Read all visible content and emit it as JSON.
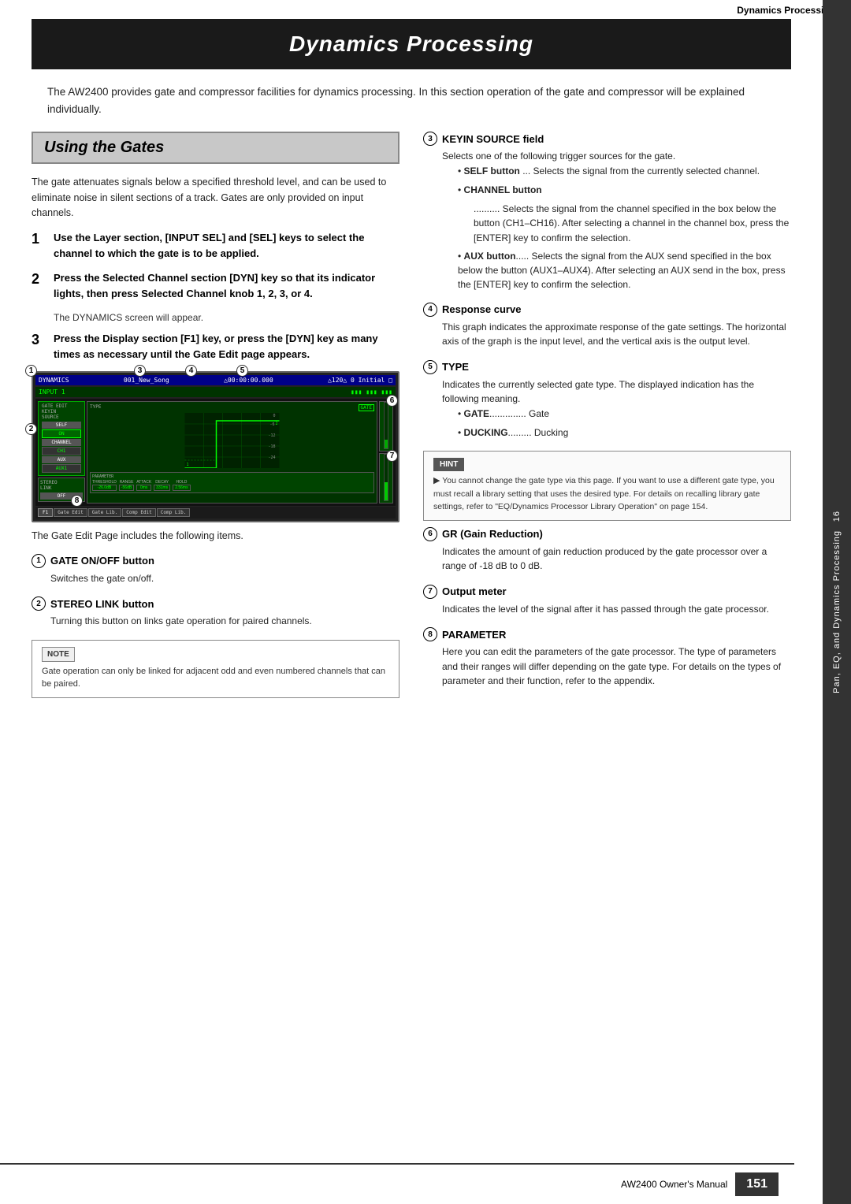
{
  "topBar": {
    "title": "Dynamics Processing"
  },
  "mainTitle": "Dynamics Processing",
  "intro": "The AW2400 provides gate and compressor facilities for dynamics processing. In this section operation of the gate and compressor will be explained individually.",
  "sectionTitle": "Using the Gates",
  "sectionIntro": "The gate attenuates signals below a specified threshold level, and can be used to eliminate noise in silent sections of a track. Gates are only provided on input channels.",
  "steps": [
    {
      "number": "1",
      "text": "Use the Layer section, [INPUT SEL] and [SEL] keys to select the channel to which the gate is to be applied."
    },
    {
      "number": "2",
      "text": "Press the Selected Channel section [DYN] key so that its indicator lights, then press Selected Channel knob 1, 2, 3, or 4.",
      "note": "The DYNAMICS screen will appear."
    },
    {
      "number": "3",
      "text": "Press the Display section [F1] key, or press the [DYN] key as many times as necessary until the Gate Edit page appears."
    }
  ],
  "screenCaption": "The Gate Edit Page includes the following items.",
  "noteBox": {
    "label": "NOTE",
    "content": "Gate operation can only be linked for adjacent odd and even numbered channels that can be paired."
  },
  "items": [
    {
      "number": "1",
      "title": "GATE ON/OFF button",
      "body": "Switches the gate on/off."
    },
    {
      "number": "2",
      "title": "STEREO LINK button",
      "body": "Turning this button on links gate operation for paired channels."
    },
    {
      "number": "3",
      "title": "KEYIN SOURCE field",
      "body": "Selects one of the following trigger sources for the gate.",
      "bullets": [
        {
          "label": "SELF button",
          "labelSuffix": "... Selects the signal from the currently selected channel."
        },
        {
          "label": "CHANNEL button",
          "labelSuffix": ""
        }
      ],
      "channelSubtext": ".......... Selects the signal from the channel specified in the box below the button (CH1–CH16). After selecting a channel in the channel box, press the [ENTER] key to confirm the selection.",
      "auxBullet": {
        "label": "AUX button",
        "text": "..... Selects the signal from the AUX send specified in the box below the button (AUX1–AUX4). After selecting an AUX send in the box, press the [ENTER] key to confirm the selection."
      }
    },
    {
      "number": "4",
      "title": "Response curve",
      "body": "This graph indicates the approximate response of the gate settings. The horizontal axis of the graph is the input level, and the vertical axis is the output level."
    },
    {
      "number": "5",
      "title": "TYPE",
      "body": "Indicates the currently selected gate type. The displayed indication has the following meaning.",
      "bullets": [
        {
          "label": "GATE",
          "labelSuffix": ".............. Gate"
        },
        {
          "label": "DUCKING",
          "labelSuffix": "......... Ducking"
        }
      ]
    },
    {
      "number": "6",
      "title": "GR (Gain Reduction)",
      "body": "Indicates the amount of gain reduction produced by the gate processor over a range of -18 dB to 0 dB."
    },
    {
      "number": "7",
      "title": "Output meter",
      "body": "Indicates the level of the signal after it has passed through the gate processor."
    },
    {
      "number": "8",
      "title": "PARAMETER",
      "body": "Here you can edit the parameters of the gate processor. The type of parameters and their ranges will differ depending on the gate type. For details on the types of parameter and their function, refer to the appendix."
    }
  ],
  "hintBox": {
    "label": "HINT",
    "content": "You cannot change the gate type via this page. If you want to use a different gate type, you must recall a library setting that uses the desired type. For details on recalling library gate settings, refer to \"EQ/Dynamics Processor Library Operation\" on page 154."
  },
  "sidebar": {
    "text": "Pan, EQ, and Dynamics Processing",
    "chapter": "16"
  },
  "footer": {
    "brand": "AW2400 Owner's Manual",
    "pageNum": "151"
  }
}
